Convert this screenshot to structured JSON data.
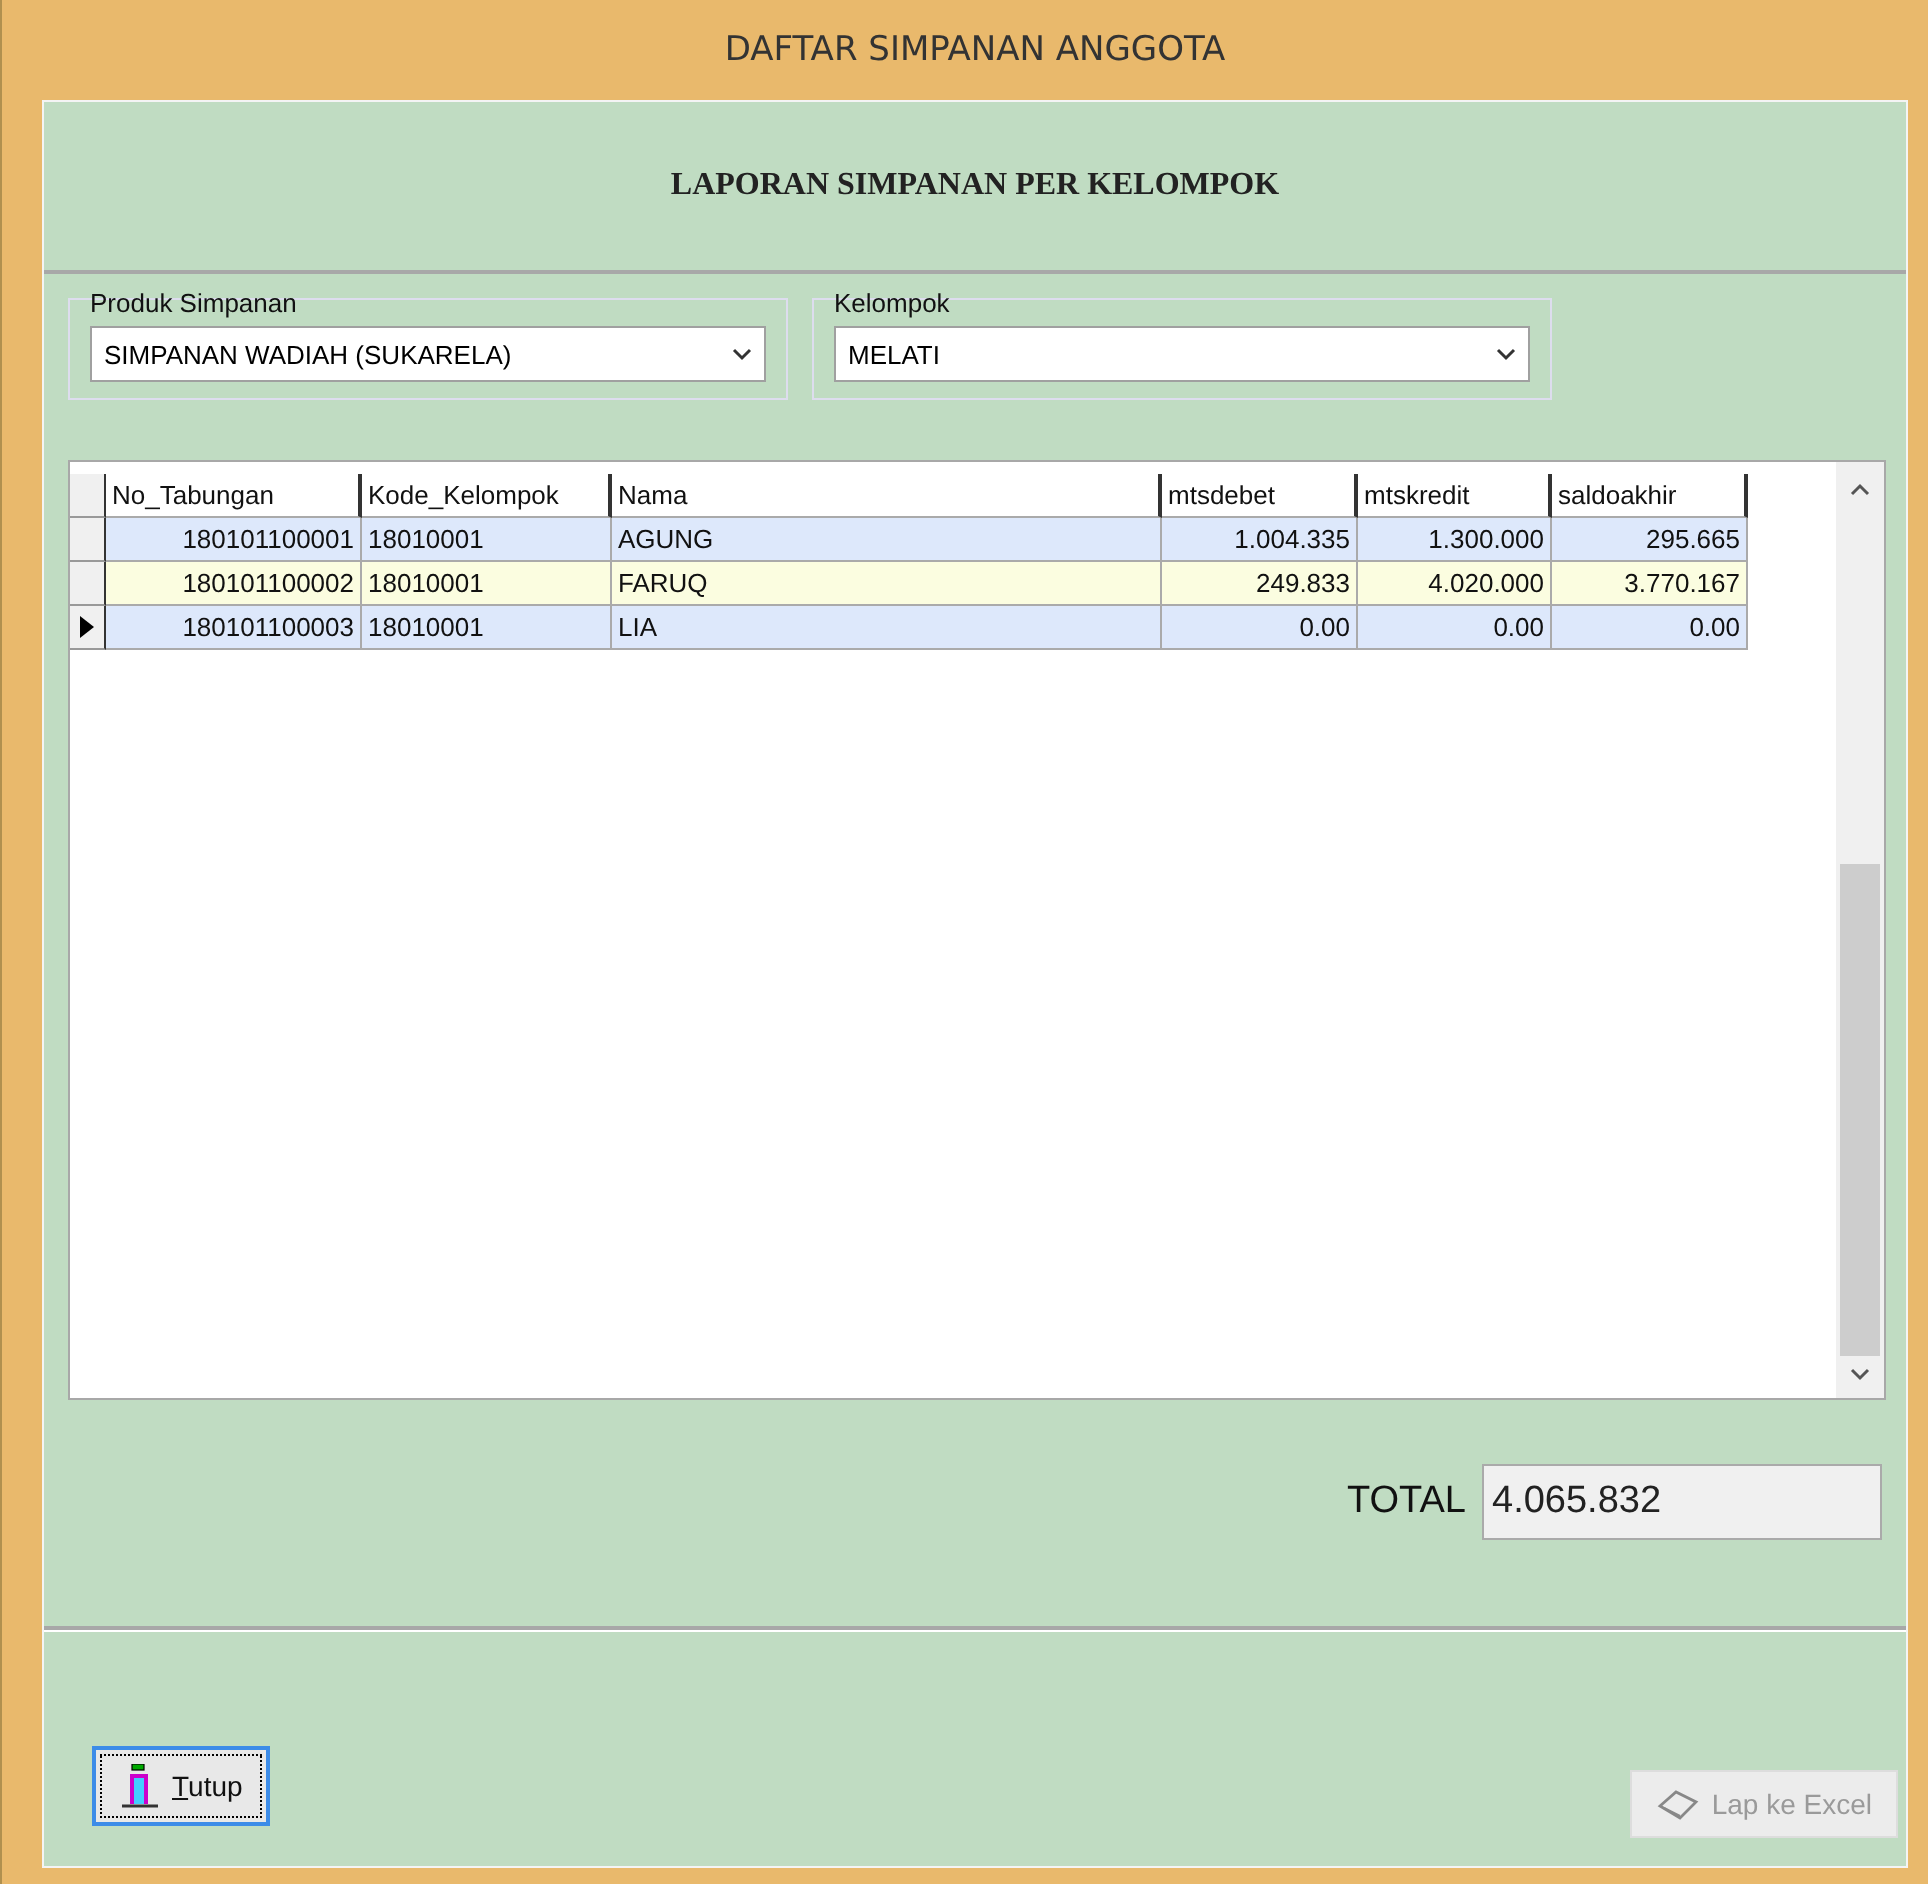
{
  "window": {
    "title": "DAFTAR SIMPANAN ANGGOTA"
  },
  "header": {
    "title": "LAPORAN SIMPANAN PER KELOMPOK"
  },
  "filters": [
    {
      "label": "Produk Simpanan",
      "value": "SIMPANAN WADIAH (SUKARELA)"
    },
    {
      "label": "Kelompok",
      "value": "MELATI"
    }
  ],
  "table": {
    "columns": [
      {
        "label": "No_Tabungan"
      },
      {
        "label": "Kode_Kelompok"
      },
      {
        "label": "Nama"
      },
      {
        "label": "mtsdebet"
      },
      {
        "label": "mtskredit"
      },
      {
        "label": "saldoakhir"
      }
    ],
    "rows": [
      {
        "selected": false,
        "cells": [
          "180101100001",
          "18010001",
          "AGUNG",
          "1.004.335",
          "1.300.000",
          "295.665"
        ]
      },
      {
        "selected": false,
        "cells": [
          "180101100002",
          "18010001",
          "FARUQ",
          "249.833",
          "4.020.000",
          "3.770.167"
        ]
      },
      {
        "selected": true,
        "cells": [
          "180101100003",
          "18010001",
          "LIA",
          "0.00",
          "0.00",
          "0.00"
        ]
      }
    ]
  },
  "total": {
    "label": "TOTAL",
    "value": "4.065.832"
  },
  "buttons": [
    {
      "kind": "close",
      "label": "Tutup",
      "disabled": false
    },
    {
      "kind": "excel",
      "label": "Lap ke Excel",
      "disabled": true
    }
  ]
}
